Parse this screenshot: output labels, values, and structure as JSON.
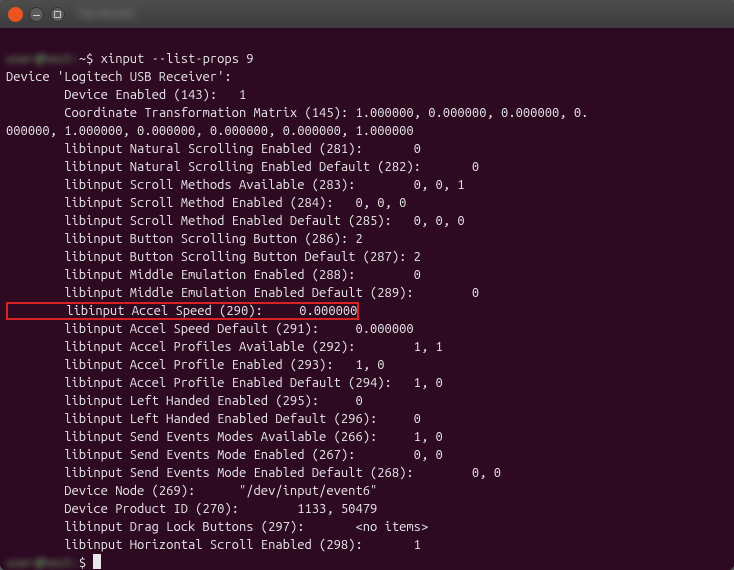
{
  "window": {
    "title": "Terminal"
  },
  "prompt": {
    "user_host": "user@host:",
    "tilde": "~$ ",
    "command": "xinput --list-props 9",
    "prompt2_user": "user@host:",
    "prompt2_tilde": "$ "
  },
  "output": {
    "device_line": "Device 'Logitech USB Receiver':",
    "lines_pre": [
      "        Device Enabled (143):   1",
      "        Coordinate Transformation Matrix (145): 1.000000, 0.000000, 0.000000, 0.",
      "000000, 1.000000, 0.000000, 0.000000, 0.000000, 1.000000",
      "        libinput Natural Scrolling Enabled (281):       0",
      "        libinput Natural Scrolling Enabled Default (282):       0",
      "        libinput Scroll Methods Available (283):        0, 0, 1",
      "        libinput Scroll Method Enabled (284):   0, 0, 0",
      "        libinput Scroll Method Enabled Default (285):   0, 0, 0",
      "        libinput Button Scrolling Button (286): 2",
      "        libinput Button Scrolling Button Default (287): 2",
      "        libinput Middle Emulation Enabled (288):        0",
      "        libinput Middle Emulation Enabled Default (289):        0"
    ],
    "highlight_line": "        libinput Accel Speed (290):     0.000000",
    "lines_post": [
      "        libinput Accel Speed Default (291):     0.000000",
      "        libinput Accel Profiles Available (292):        1, 1",
      "        libinput Accel Profile Enabled (293):   1, 0",
      "        libinput Accel Profile Enabled Default (294):   1, 0",
      "        libinput Left Handed Enabled (295):     0",
      "        libinput Left Handed Enabled Default (296):     0",
      "        libinput Send Events Modes Available (266):     1, 0",
      "        libinput Send Events Mode Enabled (267):        0, 0",
      "        libinput Send Events Mode Enabled Default (268):        0, 0",
      "        Device Node (269):      \"/dev/input/event6\"",
      "        Device Product ID (270):        1133, 50479",
      "        libinput Drag Lock Buttons (297):       <no items>",
      "        libinput Horizontal Scroll Enabled (298):       1"
    ]
  }
}
